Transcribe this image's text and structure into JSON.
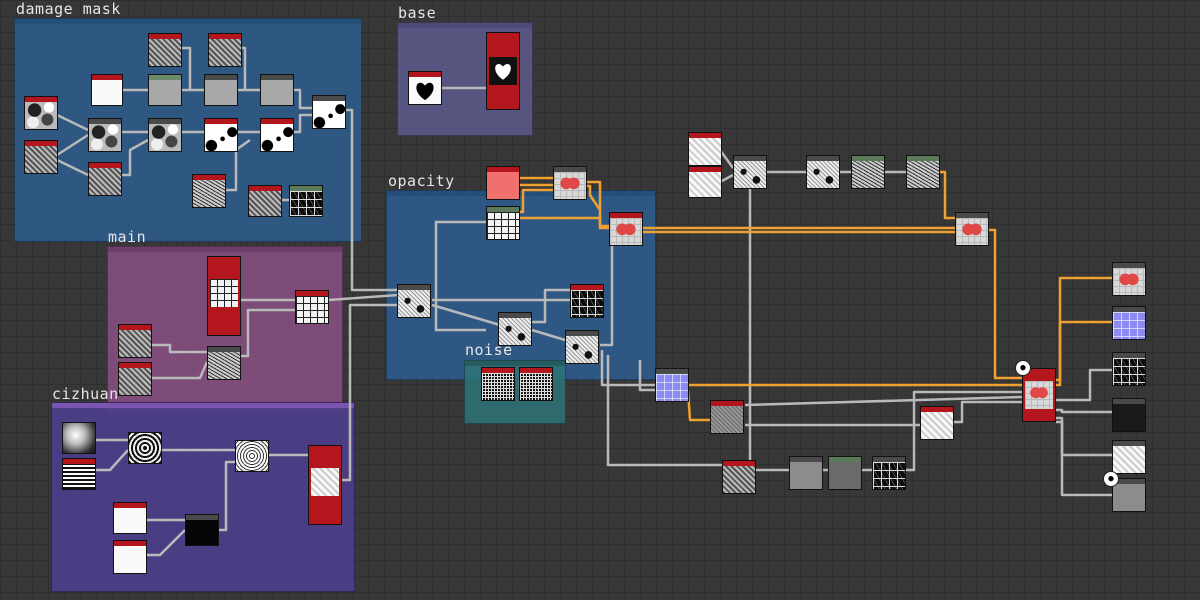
{
  "frames": [
    {
      "id": "damage-mask",
      "title": "damage mask",
      "color": "#2f5f8c"
    },
    {
      "id": "base",
      "title": "base",
      "color": "#5b5a8c"
    },
    {
      "id": "opacity",
      "title": "opacity",
      "color": "#2f5f8c"
    },
    {
      "id": "main",
      "title": "main",
      "color": "#8a4f86"
    },
    {
      "id": "noise",
      "title": "noise",
      "color": "#2f7478"
    },
    {
      "id": "cizhuan",
      "title": "cizhuan",
      "color": "#4e3d8c"
    }
  ],
  "colors": {
    "background": "#373737",
    "node_header": "#b3161d",
    "wire_default": "#b9b9b9",
    "wire_highlight": "#f0a030"
  },
  "icons": {
    "heart_mask": "heart-icon",
    "output_badges": [
      "output-badge-icon",
      "output-badge-icon"
    ]
  }
}
